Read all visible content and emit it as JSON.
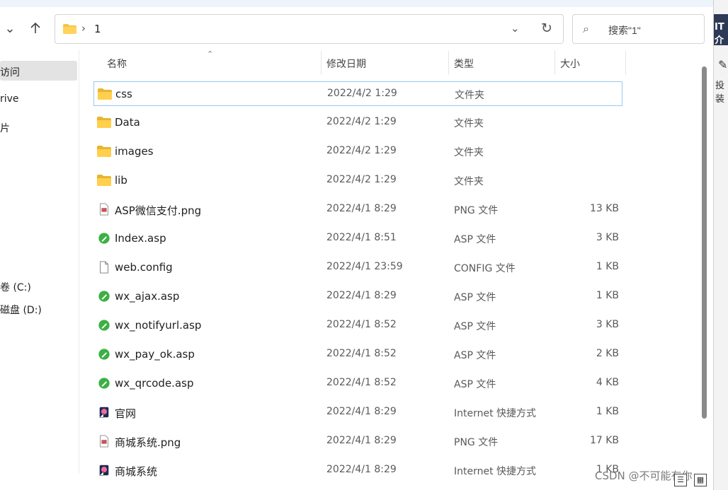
{
  "address_bar": {
    "crumb_separator": "›",
    "crumbs": [
      "1"
    ],
    "search_placeholder": "搜索\"1\""
  },
  "nav_pane": {
    "items": [
      {
        "label": "访问",
        "selected": true
      },
      {
        "label": "rive"
      },
      {
        "label": "片"
      },
      {
        "label": "卷 (C:)"
      },
      {
        "label": "磁盘 (D:)"
      }
    ]
  },
  "columns": {
    "name": "名称",
    "date": "修改日期",
    "type": "类型",
    "size": "大小"
  },
  "files": [
    {
      "name": "css",
      "date": "2022/4/2 1:29",
      "type": "文件夹",
      "size": "",
      "icon": "folder-icon",
      "selected": true
    },
    {
      "name": "Data",
      "date": "2022/4/2 1:29",
      "type": "文件夹",
      "size": "",
      "icon": "folder-icon"
    },
    {
      "name": "images",
      "date": "2022/4/2 1:29",
      "type": "文件夹",
      "size": "",
      "icon": "folder-icon"
    },
    {
      "name": "lib",
      "date": "2022/4/2 1:29",
      "type": "文件夹",
      "size": "",
      "icon": "folder-icon"
    },
    {
      "name": "ASP微信支付.png",
      "date": "2022/4/1 8:29",
      "type": "PNG 文件",
      "size": "13 KB",
      "icon": "image-file-icon"
    },
    {
      "name": "Index.asp",
      "date": "2022/4/1 8:51",
      "type": "ASP 文件",
      "size": "3 KB",
      "icon": "asp-file-icon"
    },
    {
      "name": "web.config",
      "date": "2022/4/1 23:59",
      "type": "CONFIG 文件",
      "size": "1 KB",
      "icon": "blank-file-icon"
    },
    {
      "name": "wx_ajax.asp",
      "date": "2022/4/1 8:29",
      "type": "ASP 文件",
      "size": "1 KB",
      "icon": "asp-file-icon"
    },
    {
      "name": "wx_notifyurl.asp",
      "date": "2022/4/1 8:52",
      "type": "ASP 文件",
      "size": "3 KB",
      "icon": "asp-file-icon"
    },
    {
      "name": "wx_pay_ok.asp",
      "date": "2022/4/1 8:52",
      "type": "ASP 文件",
      "size": "2 KB",
      "icon": "asp-file-icon"
    },
    {
      "name": "wx_qrcode.asp",
      "date": "2022/4/1 8:52",
      "type": "ASP 文件",
      "size": "4 KB",
      "icon": "asp-file-icon"
    },
    {
      "name": "官网",
      "date": "2022/4/1 8:29",
      "type": "Internet 快捷方式",
      "size": "1 KB",
      "icon": "internet-shortcut-icon"
    },
    {
      "name": "商城系统.png",
      "date": "2022/4/1 8:29",
      "type": "PNG 文件",
      "size": "17 KB",
      "icon": "image-file-icon"
    },
    {
      "name": "商城系统",
      "date": "2022/4/1 8:29",
      "type": "Internet 快捷方式",
      "size": "1 KB",
      "icon": "internet-shortcut-icon"
    }
  ],
  "right_window": {
    "banner_text": "IT 介",
    "label": "投装"
  },
  "watermark": "CSDN @不可能有你",
  "colors": {
    "selection_border": "#99c9ef",
    "folder": "#f4c542",
    "asp_green": "#3cb043"
  }
}
